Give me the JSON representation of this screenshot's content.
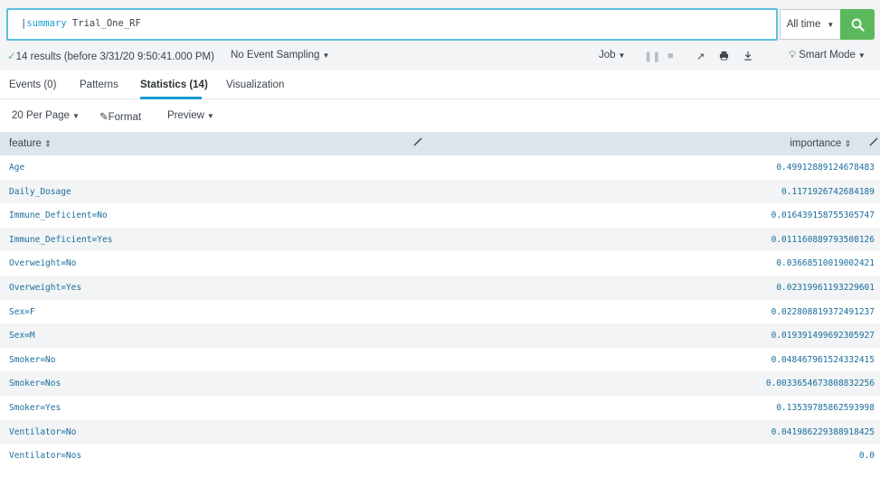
{
  "search": {
    "pipe": "|",
    "command": "summary",
    "argument": "Trial_One_RF",
    "time_range": "All time"
  },
  "status": {
    "results": "14 results (before 3/31/20 9:50:41.000 PM)",
    "sampling": "No Event Sampling",
    "job": "Job",
    "mode": "Smart Mode"
  },
  "tabs": [
    {
      "label": "Events (0)"
    },
    {
      "label": "Patterns"
    },
    {
      "label": "Statistics (14)"
    },
    {
      "label": "Visualization"
    }
  ],
  "options": {
    "per_page": "20 Per Page",
    "format": "Format",
    "preview": "Preview"
  },
  "table": {
    "columns": [
      "feature",
      "importance"
    ],
    "rows": [
      {
        "feature": "Age",
        "importance": "0.49912889124678483"
      },
      {
        "feature": "Daily_Dosage",
        "importance": "0.1171926742684189"
      },
      {
        "feature": "Immune_Deficient=No",
        "importance": "0.016439158755305747"
      },
      {
        "feature": "Immune_Deficient=Yes",
        "importance": "0.011160889793508126"
      },
      {
        "feature": "Overweight=No",
        "importance": "0.03668510019002421"
      },
      {
        "feature": "Overweight=Yes",
        "importance": "0.02319961193229601"
      },
      {
        "feature": "Sex=F",
        "importance": "0.022808819372491237"
      },
      {
        "feature": "Sex=M",
        "importance": "0.019391499692305927"
      },
      {
        "feature": "Smoker=No",
        "importance": "0.048467961524332415"
      },
      {
        "feature": "Smoker=Nos",
        "importance": "0.0033654673808832256"
      },
      {
        "feature": "Smoker=Yes",
        "importance": "0.13539785862593998"
      },
      {
        "feature": "Ventilator=No",
        "importance": "0.041986229388918425"
      },
      {
        "feature": "Ventilator=Nos",
        "importance": "0.0"
      }
    ]
  },
  "icons": {
    "search": "search-icon",
    "check": "check-icon",
    "pause": "pause-icon",
    "stop": "stop-icon",
    "share": "share-icon",
    "print": "print-icon",
    "export": "download-icon",
    "bulb": "lightbulb-icon",
    "pencil": "pencil-icon",
    "sort": "sort-icon"
  },
  "colors": {
    "accent": "#1a9bd6",
    "search_button": "#5cb85c",
    "value_text": "#1a6e9c"
  }
}
